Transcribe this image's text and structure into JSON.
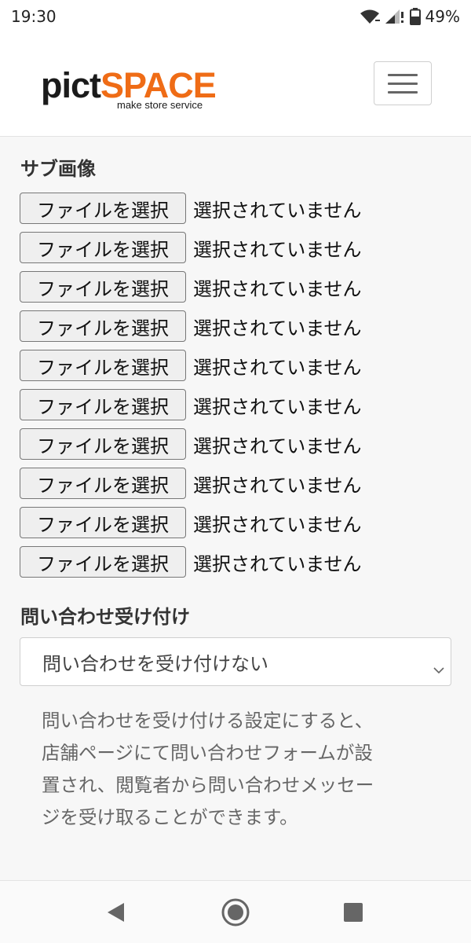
{
  "status": {
    "time": "19:30",
    "battery": "49%"
  },
  "header": {
    "logo_pict": "pict",
    "logo_space": "SPACE",
    "logo_tagline": "make store service",
    "accent_color": "#ef6c16"
  },
  "sub_images": {
    "title": "サブ画像",
    "button_label": "ファイルを選択",
    "status_text": "選択されていません",
    "count": 10
  },
  "inquiry": {
    "title": "問い合わせ受け付け",
    "selected": "問い合わせを受け付けない",
    "help_lines": [
      "問い合わせを受け付ける設定にすると、",
      "店舗ページにて問い合わせフォームが設",
      "置され、閲覧者から問い合わせメッセー",
      "ジを受け取ることができます。"
    ]
  },
  "icons": {
    "status": [
      "wifi-icon",
      "cellular-signal-icon",
      "battery-icon"
    ],
    "nav": [
      "back-icon",
      "home-icon",
      "recent-apps-icon"
    ]
  }
}
